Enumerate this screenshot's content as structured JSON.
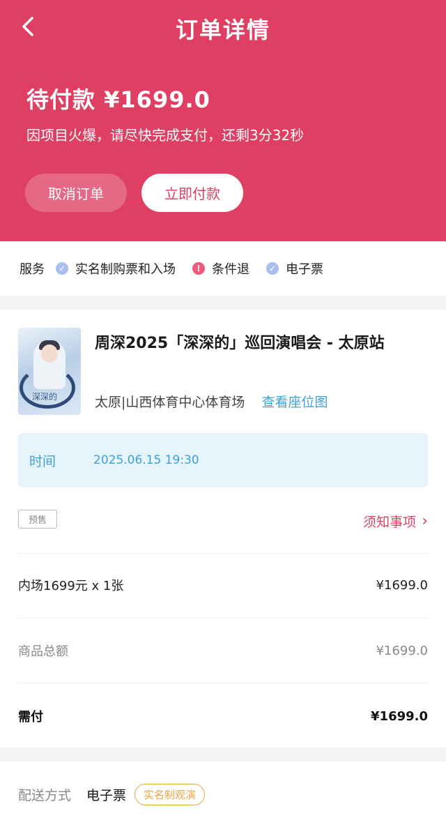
{
  "header": {
    "title": "订单详情",
    "status": "待付款 ¥1699.0",
    "countdown": "因项目火爆，请尽快完成支付，还剩3分32秒",
    "cancel_label": "取消订单",
    "pay_label": "立即付款",
    "accent_color": "#de3f62"
  },
  "services": {
    "label": "服务",
    "items": [
      {
        "text": "实名制购票和入场",
        "icon": "check-circle-icon"
      },
      {
        "text": "条件退",
        "icon": "alert-circle-icon"
      },
      {
        "text": "电子票",
        "icon": "check-circle-icon"
      }
    ]
  },
  "event": {
    "title": "周深2025「深深的」巡回演唱会 - 太原站",
    "venue": "太原|山西体育中心体育场",
    "seatmap_label": "查看座位图",
    "poster_text": "深深的"
  },
  "time": {
    "label": "时间",
    "value": "2025.06.15 19:30"
  },
  "presale_tag": "预售",
  "notice_label": "须知事项",
  "rows": [
    {
      "label": "内场1699元 x 1张",
      "value": "¥1699.0"
    },
    {
      "label": "商品总额",
      "value": "¥1699.0"
    },
    {
      "label": "需付",
      "value": "¥1699.0"
    }
  ],
  "delivery": {
    "label": "配送方式",
    "value": "电子票",
    "tag": "实名制观演"
  }
}
